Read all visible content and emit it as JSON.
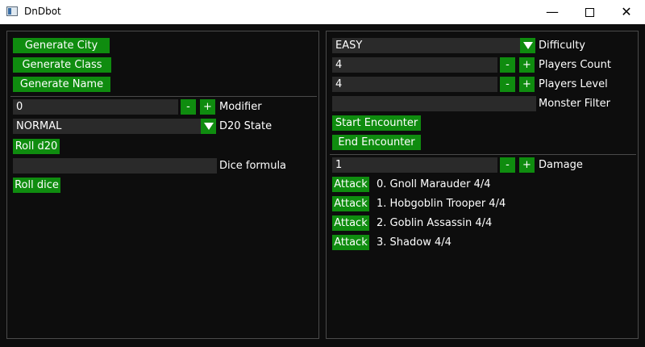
{
  "window": {
    "title": "DnDbot",
    "minimize": "—",
    "close": "✕"
  },
  "left": {
    "generate_city": "Generate City",
    "generate_class": "Generate Class",
    "generate_name": "Generate Name",
    "modifier_value": "0",
    "minus": "-",
    "plus": "+",
    "modifier_label": "Modifier",
    "d20_state_value": "NORMAL",
    "d20_state_label": "D20 State",
    "roll_d20": "Roll d20",
    "dice_formula_value": "",
    "dice_formula_label": "Dice formula",
    "roll_dice": "Roll dice"
  },
  "right": {
    "difficulty_value": "EASY",
    "difficulty_label": "Difficulty",
    "players_count_value": "4",
    "players_count_label": "Players Count",
    "players_level_value": "4",
    "players_level_label": "Players Level",
    "monster_filter_value": "",
    "monster_filter_label": "Monster Filter",
    "start_encounter": "Start Encounter",
    "end_encounter": "End Encounter",
    "damage_value": "1",
    "damage_label": "Damage",
    "minus": "-",
    "plus": "+",
    "attack_label": "Attack",
    "monsters": [
      "0. Gnoll Marauder 4/4",
      "1. Hobgoblin Trooper 4/4",
      "2. Goblin Assassin 4/4",
      "3. Shadow 4/4"
    ]
  },
  "colors": {
    "accent": "#0f8c0f",
    "background": "#0d0d0d",
    "field": "#2a2a2a",
    "border": "#4a4a4a"
  }
}
